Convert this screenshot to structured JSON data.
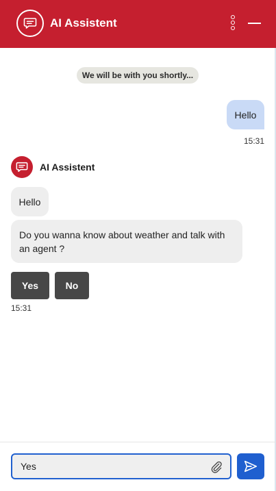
{
  "header": {
    "title": "AI Assistent",
    "avatar_icon": "chat-bubble-icon",
    "menu_icon": "kebab-menu-icon",
    "minimize_icon": "minimize-icon",
    "background": "#c51f2f"
  },
  "status": {
    "text": "We will be with you shortly..."
  },
  "messages": {
    "user_message": "Hello",
    "user_time": "15:31",
    "bot_name": "AI Assistent",
    "bot_message_1": "Hello",
    "bot_message_2": "Do you wanna know about weather and talk with an agent ?",
    "bot_time": "15:31"
  },
  "quick_replies": {
    "yes_label": "Yes",
    "no_label": "No"
  },
  "composer": {
    "value": "Yes",
    "attach_icon": "paperclip-icon",
    "send_icon": "send-icon",
    "accent": "#1f5fcf"
  }
}
